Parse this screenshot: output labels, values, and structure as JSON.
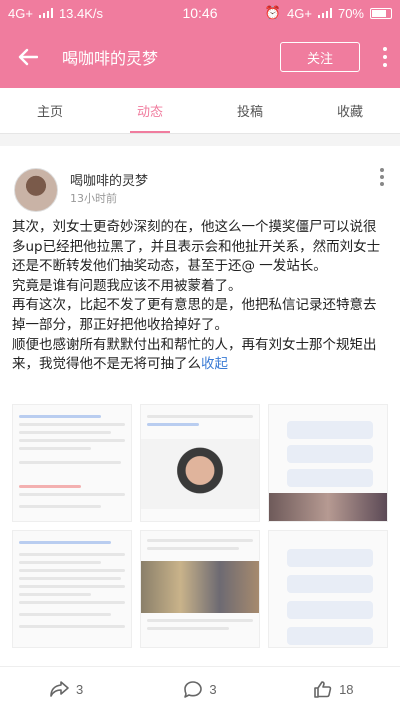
{
  "status_bar": {
    "network": "4G+",
    "speed": "13.4K/s",
    "time": "10:46",
    "network_right": "4G+",
    "battery": "70%"
  },
  "app_bar": {
    "title": "喝咖啡的灵梦",
    "follow_label": "关注"
  },
  "tabs": [
    {
      "label": "主页",
      "active": false
    },
    {
      "label": "动态",
      "active": true
    },
    {
      "label": "投稿",
      "active": false
    },
    {
      "label": "收藏",
      "active": false
    }
  ],
  "post": {
    "author": "喝咖啡的灵梦",
    "time": "13小时前",
    "paragraphs": [
      "其次，刘女士更奇妙深刻的在，他这么一个摸奖僵尸可以说很多up已经把他拉黑了，并且表示会和他扯开关系，然而刘女士还是不断转发他们抽奖动态，甚至于还@ 一发站长。",
      "究竟是谁有问题我应该不用被蒙着了。",
      "再有这次，比起不发了更有意思的是，他把私信记录还特意去掉一部分，那正好把他收拾掉好了。",
      "顺便也感谢所有默默付出和帮忙的人，再有刘女士那个规矩出来，我觉得他不是无将可抽了么"
    ],
    "collapse_label": "收起",
    "image_count": 6
  },
  "actions": {
    "share_count": "3",
    "comment_count": "3",
    "like_count": "18"
  },
  "colors": {
    "brand": "#f07c9e",
    "link": "#3a7bd5"
  }
}
